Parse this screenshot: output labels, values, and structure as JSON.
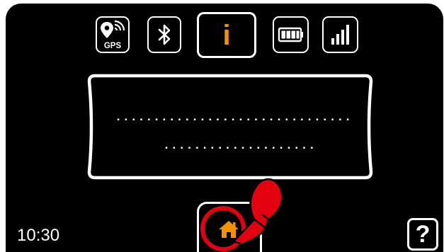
{
  "status_tabs": [
    {
      "name": "gps",
      "icon": "gps-icon",
      "label": "GPS"
    },
    {
      "name": "bluetooth",
      "icon": "bluetooth-icon"
    },
    {
      "name": "info",
      "icon": "info-icon",
      "label": "i",
      "active": true
    },
    {
      "name": "battery",
      "icon": "battery-icon",
      "battery_level": 1.0
    },
    {
      "name": "signal",
      "icon": "signal-icon",
      "signal_bars": 4
    }
  ],
  "message": {
    "line1": "...............................",
    "line2": "...................."
  },
  "clock": "10:30",
  "home": {
    "icon": "home-icon"
  },
  "help": {
    "label": "?",
    "icon": "help-icon"
  },
  "gesture": {
    "icon": "tap-hand-icon"
  },
  "colors": {
    "background": "#000000",
    "foreground": "#ffffff",
    "accent": "#f39200",
    "gesture": "#e3000f"
  }
}
